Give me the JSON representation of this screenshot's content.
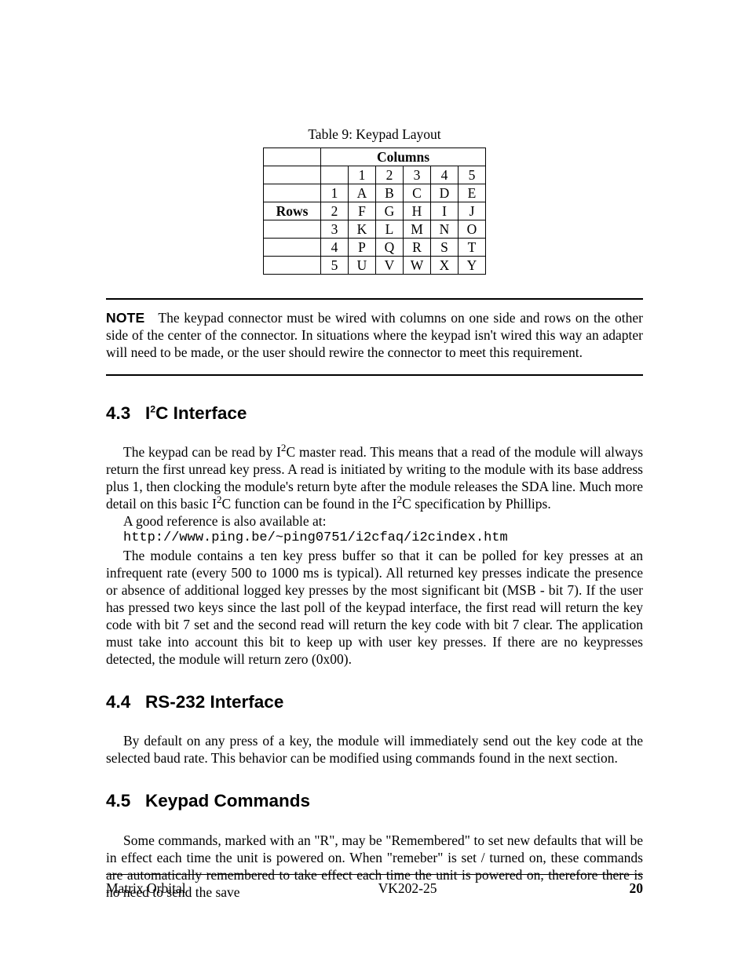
{
  "table_caption": "Table 9: Keypad Layout",
  "table": {
    "columns_header": "Columns",
    "rows_header": "Rows",
    "col_nums": [
      "1",
      "2",
      "3",
      "4",
      "5"
    ],
    "rows": [
      {
        "num": "1",
        "cells": [
          "A",
          "B",
          "C",
          "D",
          "E"
        ]
      },
      {
        "num": "2",
        "cells": [
          "F",
          "G",
          "H",
          "I",
          "J"
        ]
      },
      {
        "num": "3",
        "cells": [
          "K",
          "L",
          "M",
          "N",
          "O"
        ]
      },
      {
        "num": "4",
        "cells": [
          "P",
          "Q",
          "R",
          "S",
          "T"
        ]
      },
      {
        "num": "5",
        "cells": [
          "U",
          "V",
          "W",
          "X",
          "Y"
        ]
      }
    ]
  },
  "note": {
    "label": "NOTE",
    "text": "The keypad connector must be wired with columns on one side and rows on the other side of the center of the connector.  In situations where the keypad isn't wired this way an adapter will need to be made, or the user should rewire the connector to meet this requirement."
  },
  "s43": {
    "num": "4.3",
    "title_pre": "I",
    "title_sup": "2",
    "title_post": "C Interface",
    "p1a": "The keypad can be read by I",
    "p1b": "C master read. This means that a read of the module will always return the first unread key press. A read is initiated by writing to the module with its base address plus 1, then clocking the module's return byte after the module releases the SDA line. Much more detail on this basic I",
    "p1c": "C function can be found in the I",
    "p1d": "C specification by Phillips.",
    "p2": "A good reference is also available at:",
    "url": "http://www.ping.be/~ping0751/i2cfaq/i2cindex.htm",
    "p3": "The module contains a ten key press buffer so that it can be polled for key presses at an infrequent rate (every 500 to 1000 ms is typical). All returned key presses indicate the presence or absence of additional logged key presses by the most significant bit (MSB - bit 7). If the user has pressed two keys since the last poll of the keypad interface, the first read will return the key code with bit 7 set and the second read will return the key code with bit 7 clear. The application must take into account this bit to keep up with user key presses. If there are no keypresses detected, the module will return zero (0x00)."
  },
  "s44": {
    "num": "4.4",
    "title": "RS-232 Interface",
    "p1": "By default on any press of a key, the module will immediately send out the key code at the selected baud rate. This behavior can be modified using commands found in the next section."
  },
  "s45": {
    "num": "4.5",
    "title": "Keypad Commands",
    "p1": "Some commands, marked with an \"R\", may be \"Remembered\" to set new defaults that will be in effect each time the unit is powered on.  When \"remeber\" is set / turned on, these commands are automatically remembered to take effect each time the unit is powered on, therefore there is no need to send the save"
  },
  "footer": {
    "left": "Matrix Orbital",
    "center": "VK202-25",
    "right": "20"
  }
}
